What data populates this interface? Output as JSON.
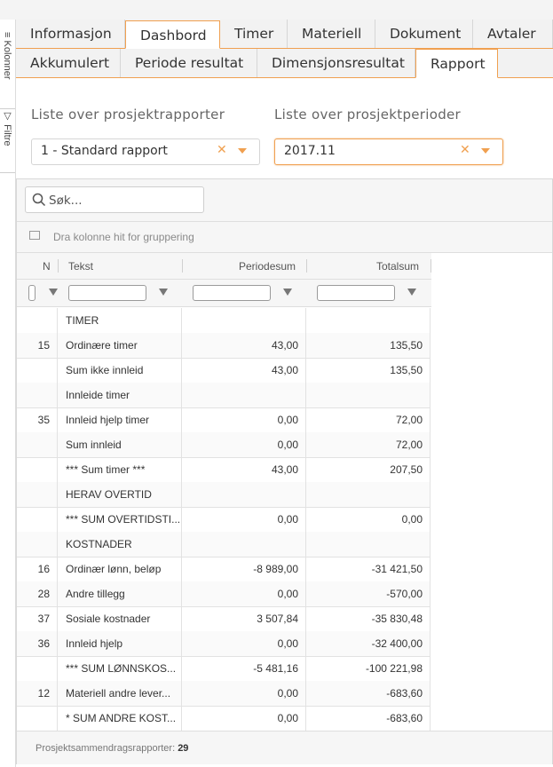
{
  "side_tabs": {
    "columns": "Kolonner",
    "filters": "Filtre"
  },
  "tabs_primary": [
    {
      "label": "Informasjon",
      "active": false
    },
    {
      "label": "Dashbord",
      "active": true
    },
    {
      "label": "Timer",
      "active": false
    },
    {
      "label": "Materiell",
      "active": false
    },
    {
      "label": "Dokument",
      "active": false
    },
    {
      "label": "Avtaler",
      "active": false
    }
  ],
  "tabs_secondary": [
    {
      "label": "Akkumulert",
      "active": false
    },
    {
      "label": "Periode resultat",
      "active": false
    },
    {
      "label": "Dimensjonsresultat",
      "active": false
    },
    {
      "label": "Rapport",
      "active": true
    }
  ],
  "report_select": {
    "label": "Liste over prosjektrapporter",
    "value": "1 - Standard rapport"
  },
  "period_select": {
    "label": "Liste over prosjektperioder",
    "value": "2017.11"
  },
  "search": {
    "placeholder": "Søk..."
  },
  "group_hint": "Dra kolonne hit for gruppering",
  "columns": {
    "nr": "N",
    "text": "Tekst",
    "period_sum": "Periodesum",
    "total_sum": "Totalsum"
  },
  "rows": [
    {
      "nr": "",
      "text": "TIMER",
      "period": "",
      "total": ""
    },
    {
      "nr": "15",
      "text": "Ordinære timer",
      "period": "43,00",
      "total": "135,50"
    },
    {
      "nr": "",
      "text": "Sum ikke innleid",
      "period": "43,00",
      "total": "135,50"
    },
    {
      "nr": "",
      "text": "Innleide timer",
      "period": "",
      "total": ""
    },
    {
      "nr": "35",
      "text": "Innleid hjelp timer",
      "period": "0,00",
      "total": "72,00"
    },
    {
      "nr": "",
      "text": "Sum innleid",
      "period": "0,00",
      "total": "72,00"
    },
    {
      "nr": "",
      "text": "*** Sum timer ***",
      "period": "43,00",
      "total": "207,50"
    },
    {
      "nr": "",
      "text": "HERAV OVERTID",
      "period": "",
      "total": ""
    },
    {
      "nr": "",
      "text": "*** SUM OVERTIDSTI...",
      "period": "0,00",
      "total": "0,00"
    },
    {
      "nr": "",
      "text": "KOSTNADER",
      "period": "",
      "total": ""
    },
    {
      "nr": "16",
      "text": "Ordinær lønn, beløp",
      "period": "-8 989,00",
      "total": "-31 421,50"
    },
    {
      "nr": "28",
      "text": "Andre tillegg",
      "period": "0,00",
      "total": "-570,00"
    },
    {
      "nr": "37",
      "text": "Sosiale kostnader",
      "period": "3 507,84",
      "total": "-35 830,48"
    },
    {
      "nr": "36",
      "text": "Innleid hjelp",
      "period": "0,00",
      "total": "-32 400,00"
    },
    {
      "nr": "",
      "text": "*** SUM LØNNSKOS...",
      "period": "-5 481,16",
      "total": "-100 221,98"
    },
    {
      "nr": "12",
      "text": "Materiell andre lever...",
      "period": "0,00",
      "total": "-683,60"
    },
    {
      "nr": "",
      "text": "* SUM ANDRE KOST...",
      "period": "0,00",
      "total": "-683,60"
    }
  ],
  "footer": {
    "label": "Prosjektsammendragsrapporter:",
    "count": "29"
  },
  "colors": {
    "accent": "#f0a050",
    "clear": "#f0a050"
  }
}
